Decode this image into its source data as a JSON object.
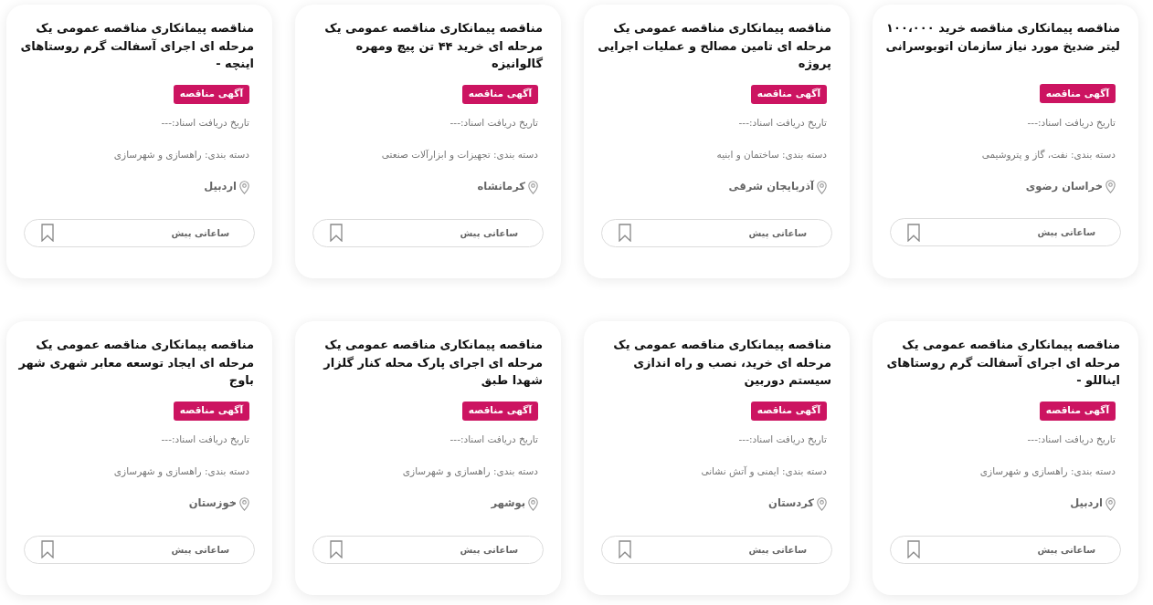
{
  "cards": [
    {
      "title": "مناقصه پیمانکاری مناقصه خرید ۱۰۰،۰۰۰ لیتر ضدیخ مورد نیاز سازمان اتوبوسرانی",
      "badge": "آگهی مناقصه",
      "document_date": "تاریخ دریافت اسناد:---",
      "category": "دسته بندی: نفت، گاز و پتروشیمی",
      "location": "خراسان رضوی",
      "posted": "ساعاتی پیش",
      "bookmarked": false
    },
    {
      "title": "مناقصه پیمانکاری مناقصه عمومی یک مرحله ای تامین مصالح و عملیات اجرایی پروژه",
      "badge": "آگهی مناقصه",
      "document_date": "تاریخ دریافت اسناد:---",
      "category": "دسته بندی: ساختمان و ابنیه",
      "location": "آذربایجان شرقی",
      "posted": "ساعاتی پیش",
      "bookmarked": false
    },
    {
      "title": "مناقصه پیمانکاری مناقصه عمومی یک مرحله ای خرید ۴۴ تن پیچ ومهره گالوانیزه",
      "badge": "آگهی مناقصه",
      "document_date": "تاریخ دریافت اسناد:---",
      "category": "دسته بندی: تجهیزات و ابزارآلات صنعتی",
      "location": "کرمانشاه",
      "posted": "ساعاتی پیش",
      "bookmarked": false
    },
    {
      "title": "مناقصه پیمانکاری مناقصه عمومی یک مرحله ای اجرای آسفالت گرم روستاهای اینچه -",
      "badge": "آگهی مناقصه",
      "document_date": "تاریخ دریافت اسناد:---",
      "category": "دسته بندی: راهسازی و شهرسازی",
      "location": "اردبیل",
      "posted": "ساعاتی پیش",
      "bookmarked": false
    },
    {
      "title": "مناقصه پیمانکاری مناقصه عمومی یک مرحله ای اجرای آسفالت گرم روستاهای ایناللو -",
      "badge": "آگهی مناقصه",
      "document_date": "تاریخ دریافت اسناد:---",
      "category": "دسته بندی: راهسازی و شهرسازی",
      "location": "اردبیل",
      "posted": "ساعاتی پیش",
      "bookmarked": false
    },
    {
      "title": "مناقصه پیمانکاری مناقصه عمومی یک مرحله ای خرید، نصب و راه اندازی سیستم دوربین",
      "badge": "آگهی مناقصه",
      "document_date": "تاریخ دریافت اسناد:---",
      "category": "دسته بندی: ایمنی و آتش نشانی",
      "location": "کردستان",
      "posted": "ساعاتی پیش",
      "bookmarked": false
    },
    {
      "title": "مناقصه پیمانکاری مناقصه عمومی یک مرحله ای اجرای پارک محله کنار گلزار شهدا طبق",
      "badge": "آگهی مناقصه",
      "document_date": "تاریخ دریافت اسناد:---",
      "category": "دسته بندی: راهسازی و شهرسازی",
      "location": "بوشهر",
      "posted": "ساعاتی پیش",
      "bookmarked": false
    },
    {
      "title": "مناقصه پیمانکاری مناقصه عمومی یک مرحله ای ایجاد توسعه معابر شهری شهر باوج",
      "badge": "آگهی مناقصه",
      "document_date": "تاریخ دریافت اسناد:---",
      "category": "دسته بندی: راهسازی و شهرسازی",
      "location": "خوزستان",
      "posted": "ساعاتی پیش",
      "bookmarked": false
    }
  ]
}
